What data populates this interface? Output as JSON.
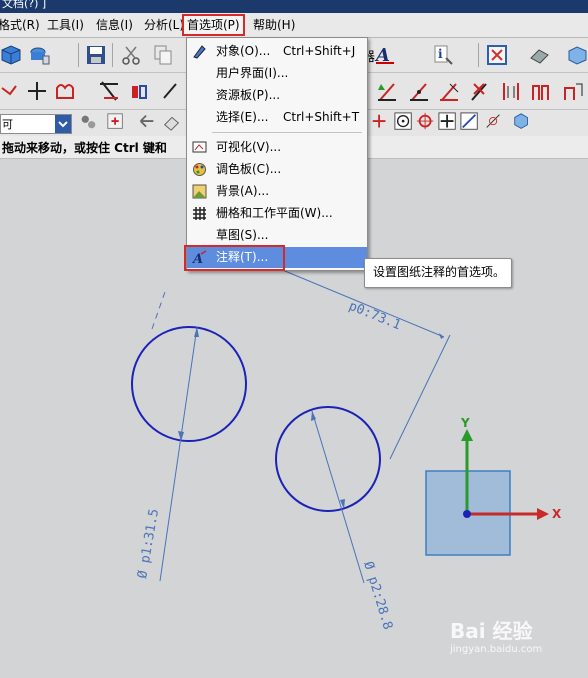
{
  "window": {
    "title": "文档(?) ]"
  },
  "menubar": {
    "items": [
      "格式(R)",
      "工具(I)",
      "信息(I)",
      "分析(L)",
      "首选项(P)",
      "帮助(H)"
    ],
    "active_index": 4
  },
  "toolbar": {
    "row3_combo_value": "可",
    "partial_label": "器"
  },
  "status": {
    "hint": "拖动来移动，或按住 Ctrl 键和"
  },
  "dropdown": {
    "items": [
      {
        "label": "对象(O)...",
        "shortcut": "Ctrl+Shift+J",
        "icon": "object-icon"
      },
      {
        "label": "用户界面(I)...",
        "shortcut": "",
        "icon": ""
      },
      {
        "label": "资源板(P)...",
        "shortcut": "",
        "icon": ""
      },
      {
        "label": "选择(E)...",
        "shortcut": "Ctrl+Shift+T",
        "icon": ""
      },
      {
        "label": "可视化(V)...",
        "shortcut": "",
        "icon": "visualization-icon"
      },
      {
        "label": "调色板(C)...",
        "shortcut": "",
        "icon": "palette-icon"
      },
      {
        "label": "背景(A)...",
        "shortcut": "",
        "icon": "background-icon"
      },
      {
        "label": "栅格和工作平面(W)...",
        "shortcut": "",
        "icon": "grid-icon"
      },
      {
        "label": "草图(S)...",
        "shortcut": "",
        "icon": ""
      },
      {
        "label": "注释(T)...",
        "shortcut": "",
        "icon": "annotation-icon"
      }
    ],
    "highlighted_index": 9
  },
  "tooltip": {
    "text": "设置图纸注释的首选项。"
  },
  "drawing": {
    "dim_top": "p0:73.1",
    "dim_left": "Ø p1:31.5",
    "dim_right": "Ø p2:28.8",
    "axis_y": "Y",
    "axis_x": "X"
  },
  "watermark": {
    "brand": "Bai 经验",
    "url": "jingyan.baidu.com"
  },
  "colors": {
    "highlight": "#5e8de0",
    "red_box": "#d42a2a",
    "circle": "#1a22b8",
    "dimension": "#4a73b8",
    "axis_y": "#2a9a2a",
    "axis_x": "#c82a2a",
    "plane": "#8fb4d8"
  }
}
